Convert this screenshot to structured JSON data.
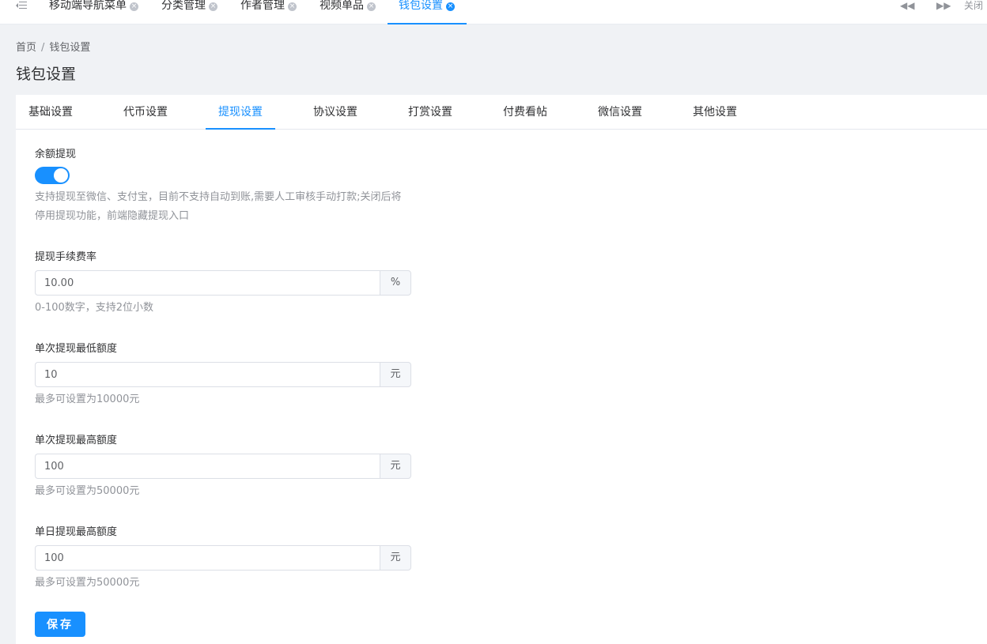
{
  "top_tabs": [
    {
      "label": "移动端导航菜单"
    },
    {
      "label": "分类管理"
    },
    {
      "label": "作者管理"
    },
    {
      "label": "视频单品"
    },
    {
      "label": "钱包设置"
    }
  ],
  "top_controls": {
    "prev": "◀◀",
    "next": "▶▶",
    "close": "关闭"
  },
  "breadcrumb": {
    "home": "首页",
    "current": "钱包设置"
  },
  "page_title": "钱包设置",
  "tabs": [
    "基础设置",
    "代币设置",
    "提现设置",
    "协议设置",
    "打赏设置",
    "付费看帖",
    "微信设置",
    "其他设置"
  ],
  "active_tab": "提现设置",
  "form": {
    "withdraw_enable": {
      "label": "余额提现",
      "enabled": true,
      "help_line1": "支持提现至微信、支付宝，目前不支持自动到账,需要人工审核手动打款;关闭后将",
      "help_line2": "停用提现功能，前端隐藏提现入口"
    },
    "fee_rate": {
      "label": "提现手续费率",
      "value": "10.00",
      "suffix": "%",
      "help": "0-100数字，支持2位小数"
    },
    "min_amount": {
      "label": "单次提现最低额度",
      "value": "10",
      "suffix": "元",
      "help": "最多可设置为10000元"
    },
    "max_amount": {
      "label": "单次提现最高额度",
      "value": "100",
      "suffix": "元",
      "help": "最多可设置为50000元"
    },
    "daily_max": {
      "label": "单日提现最高额度",
      "value": "100",
      "suffix": "元",
      "help": "最多可设置为50000元"
    },
    "save_label": "保存"
  },
  "colors": {
    "accent": "#1890ff",
    "background": "#f0f2f5"
  }
}
